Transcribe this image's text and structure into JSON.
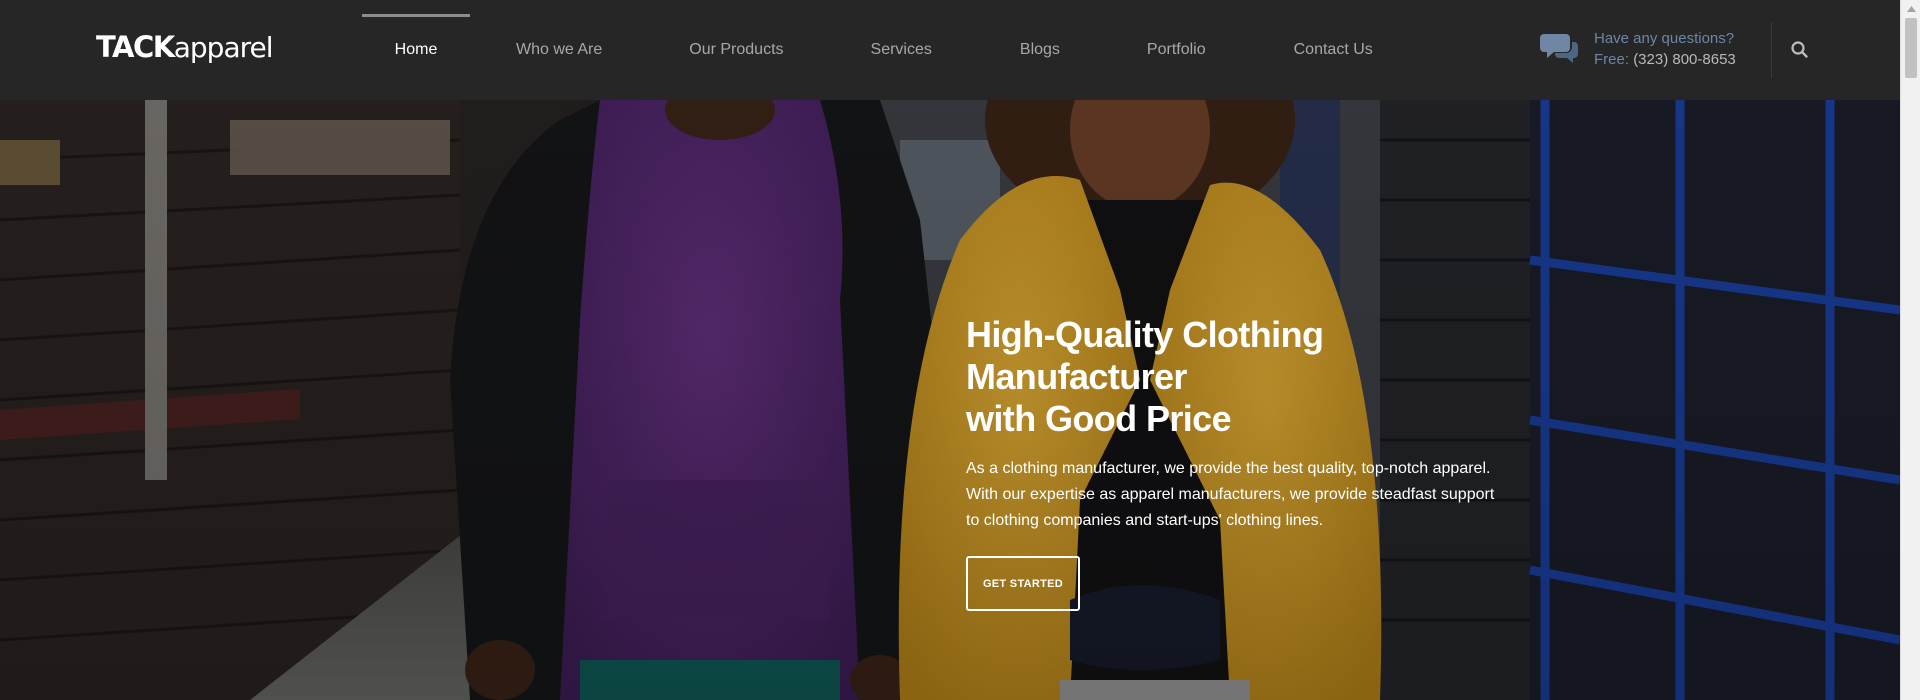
{
  "brand": {
    "logo_bold": "TACK",
    "logo_light": "apparel"
  },
  "nav": {
    "items": [
      {
        "label": "Home",
        "active": true
      },
      {
        "label": "Who we Are",
        "active": false
      },
      {
        "label": "Our Products",
        "active": false
      },
      {
        "label": "Services",
        "active": false
      },
      {
        "label": "Blogs",
        "active": false
      },
      {
        "label": "Portfolio",
        "active": false
      },
      {
        "label": "Contact Us",
        "active": false
      }
    ]
  },
  "contact": {
    "question": "Have any questions?",
    "phone_label": "Free:",
    "phone": "(323) 800-8653",
    "icon": "chat-bubbles-icon"
  },
  "search": {
    "icon": "search-icon"
  },
  "hero": {
    "title_line1": "High-Quality Clothing Manufacturer",
    "title_line2": "with Good Price",
    "desc_line1": "As a clothing manufacturer, we provide the best quality, top-notch apparel.",
    "desc_line2": "With our expertise as apparel manufacturers, we provide steadfast support",
    "desc_line3": "to clothing companies and start-ups' clothing lines.",
    "cta_label": "GET STARTED"
  },
  "colors": {
    "header_bg": "#262626",
    "nav_active": "#ffffff",
    "nav_inactive": "#a8a8a8",
    "contact_accent": "#6c87a6",
    "jacket_yellow": "#d9a52a",
    "hoodie_purple": "#5a2a78",
    "window_blue": "#1a3fa0"
  }
}
